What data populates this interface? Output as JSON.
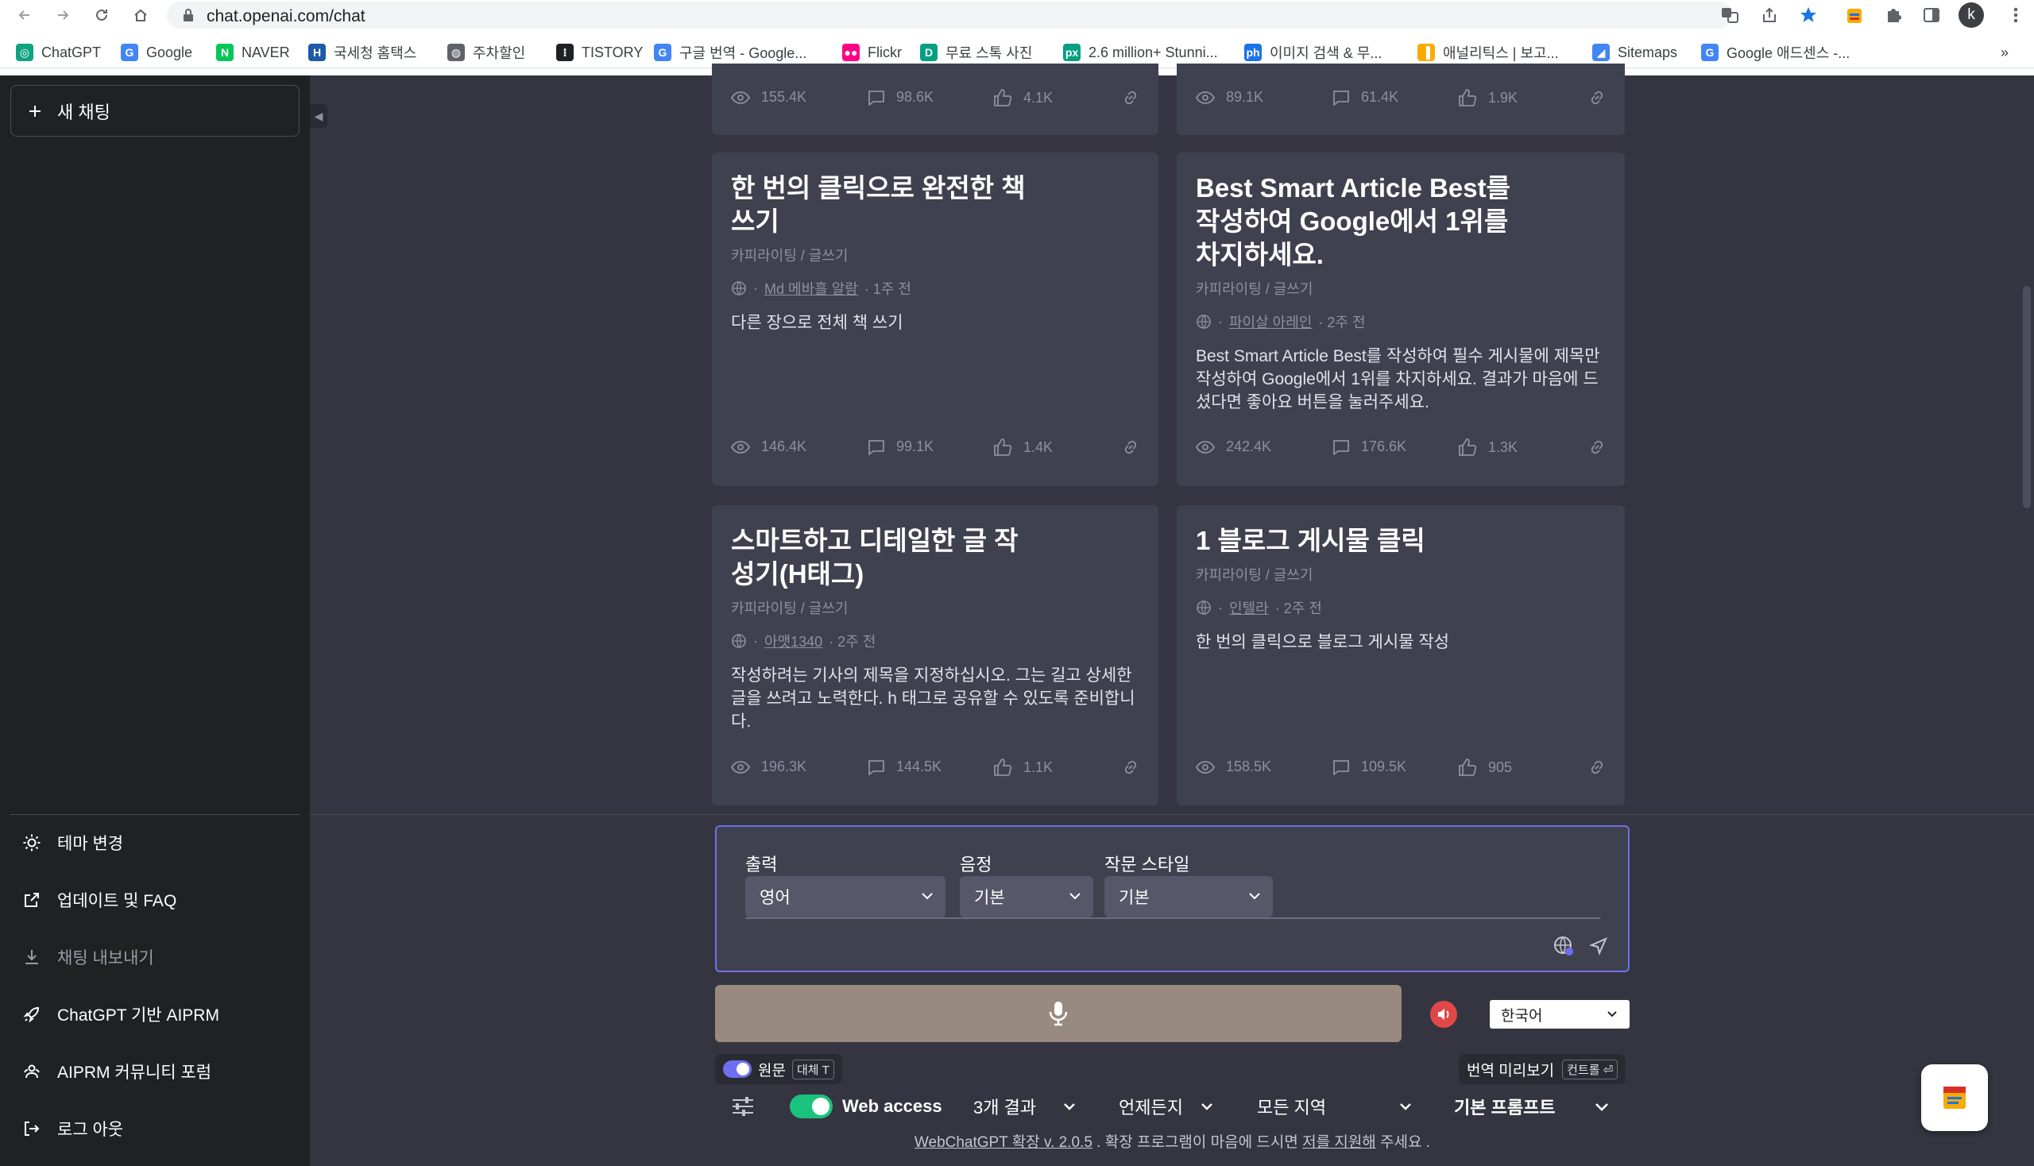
{
  "browser": {
    "url": "chat.openai.com/chat",
    "profile_initial": "k",
    "bookmarks": [
      {
        "label": "ChatGPT",
        "icon": "chatgpt-icon",
        "color": "#10a37f"
      },
      {
        "label": "Google",
        "icon": "google-icon",
        "color": "#4285f4"
      },
      {
        "label": "NAVER",
        "icon": "naver-icon",
        "color": "#03c75a"
      },
      {
        "label": "국세청 홈택스",
        "icon": "hometax-icon",
        "color": "#1e5aa8"
      },
      {
        "label": "주차할인",
        "icon": "globe-icon",
        "color": "#5f6368"
      },
      {
        "label": "TISTORY",
        "icon": "tistory-icon",
        "color": "#202124"
      },
      {
        "label": "구글 번역 - Google...",
        "icon": "google-icon",
        "color": "#4285f4"
      },
      {
        "label": "Flickr",
        "icon": "flickr-icon",
        "color": "#ff0084"
      },
      {
        "label": "무료 스톡 사진",
        "icon": "stock-photo-icon",
        "color": "#05a081"
      },
      {
        "label": "2.6 million+ Stunni...",
        "icon": "pexels-icon",
        "color": "#05a081"
      },
      {
        "label": "이미지 검색 & 무...",
        "icon": "ph-icon",
        "color": "#1a73e8"
      },
      {
        "label": "애널리틱스 | 보고...",
        "icon": "analytics-icon",
        "color": "#f9ab00"
      },
      {
        "label": "Sitemaps",
        "icon": "search-console-icon",
        "color": "#4285f4"
      },
      {
        "label": "Google 애드센스 -...",
        "icon": "google-icon",
        "color": "#4285f4"
      }
    ],
    "more_bookmarks": "»"
  },
  "sidebar": {
    "new_chat": "새 채팅",
    "items": [
      {
        "label": "테마 변경",
        "icon": "sun-icon"
      },
      {
        "label": "업데이트 및 FAQ",
        "icon": "external-link-icon"
      },
      {
        "label": "채팅 내보내기",
        "icon": "download-icon"
      },
      {
        "label": "ChatGPT 기반 AIPRM",
        "icon": "rocket-icon"
      },
      {
        "label": "AIPRM 커뮤니티 포럼",
        "icon": "community-icon"
      },
      {
        "label": "로그 아웃",
        "icon": "logout-icon"
      }
    ]
  },
  "cards": [
    {
      "title": "",
      "category": "",
      "author": "",
      "time": "",
      "description": "",
      "views": "155.4K",
      "comments": "98.6K",
      "likes": "4.1K"
    },
    {
      "title": "",
      "category": "",
      "author": "",
      "time": "",
      "description": "",
      "views": "89.1K",
      "comments": "61.4K",
      "likes": "1.9K"
    },
    {
      "title": "한 번의 클릭으로 완전한 책\n쓰기",
      "category": "카피라이팅 / 글쓰기",
      "author": "Md 메바흘 알람",
      "time": "· 1주 전",
      "description": "다른 장으로 전체 책 쓰기",
      "views": "146.4K",
      "comments": "99.1K",
      "likes": "1.4K"
    },
    {
      "title": "Best Smart Article Best를\n작성하여 Google에서 1위를\n차지하세요.",
      "category": "카피라이팅 / 글쓰기",
      "author": "파이살 아레인",
      "time": "· 2주 전",
      "description": "Best Smart Article Best를 작성하여 필수 게시물에 제목만 작성하여 Google에서 1위를 차지하세요. 결과가 마음에 드셨다면 좋아요 버튼을 눌러주세요.",
      "views": "242.4K",
      "comments": "176.6K",
      "likes": "1.3K"
    },
    {
      "title": "스마트하고 디테일한 글 작\n성기(H태그)",
      "category": "카피라이팅 / 글쓰기",
      "author": "아맷1340",
      "time": "· 2주 전",
      "description": "작성하려는 기사의 제목을 지정하십시오. 그는 길고 상세한 글을 쓰려고 노력한다. h 태그로 공유할 수 있도록 준비합니다.",
      "views": "196.3K",
      "comments": "144.5K",
      "likes": "1.1K"
    },
    {
      "title": "1 블로그 게시물 클릭",
      "category": "카피라이팅 / 글쓰기",
      "author": "인텔라",
      "time": "· 2주 전",
      "description": "한 번의 클릭으로 블로그 게시물 작성",
      "views": "158.5K",
      "comments": "109.5K",
      "likes": "905"
    }
  ],
  "composer": {
    "output_label": "출력",
    "output_value": "영어",
    "tone_label": "음정",
    "tone_value": "기본",
    "style_label": "작문 스타일",
    "style_value": "기본"
  },
  "voice": {
    "language": "한국어"
  },
  "translate_bar": {
    "original_label": "원문",
    "original_key": "대체 T",
    "preview_label": "번역 미리보기",
    "preview_key": "컨트롤 ⏎"
  },
  "webchatgpt": {
    "web_access": "Web access",
    "results": "3개 결과",
    "time": "언제든지",
    "region": "모든 지역",
    "prompt": "기본 프롬프트"
  },
  "footer": {
    "link": "WebChatGPT 확장 v. 2.0.5",
    "middle": " . 확장 프로그램이 마음에 드시면 ",
    "support": "저를 지원해",
    "end": " 주세요 ."
  },
  "colors": {
    "accent": "#6f6fe8",
    "toggle_green": "#19c37d",
    "mic_button": "#998a7f",
    "speaker": "#e04848"
  }
}
